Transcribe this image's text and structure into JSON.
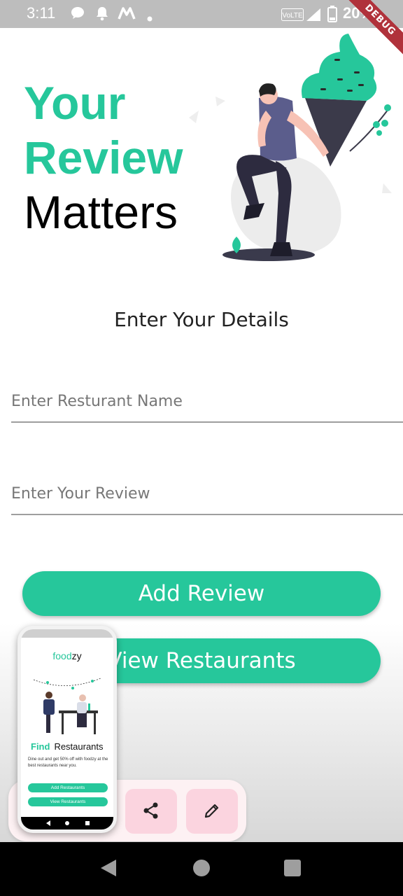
{
  "status_bar": {
    "time": "3:11",
    "battery": "20%",
    "debug_label": "DEBUG",
    "icons": [
      "chat-icon",
      "bell-icon",
      "m-logo-icon",
      "dot-icon",
      "volte-icon",
      "signal-icon",
      "battery-icon"
    ]
  },
  "hero": {
    "line1": "Your",
    "line2": "Review",
    "line3": "Matters"
  },
  "form": {
    "heading": "Enter Your Details",
    "restaurant_placeholder": "Enter Resturant Name",
    "review_placeholder": "Enter Your Review"
  },
  "buttons": {
    "add_review": "Add Review",
    "view_restaurants": "View Restaurants"
  },
  "preview": {
    "logo_accent": "food",
    "logo_rest": "zy",
    "heading_accent": "Find",
    "heading_rest": "Restaurants",
    "description": "Dine out and get 50% off with foodzy at the best restaurants near you.",
    "add_label": "Add Restaurants",
    "view_label": "View Restaurants"
  },
  "tray": {
    "icons": [
      "share-icon",
      "pencil-icon"
    ]
  },
  "nav": {
    "icons": [
      "back-icon",
      "home-icon",
      "recents-icon"
    ]
  },
  "colors": {
    "accent": "#26c79b",
    "tray_button": "#fbd4df",
    "status_bar": "#bdbdbd"
  }
}
